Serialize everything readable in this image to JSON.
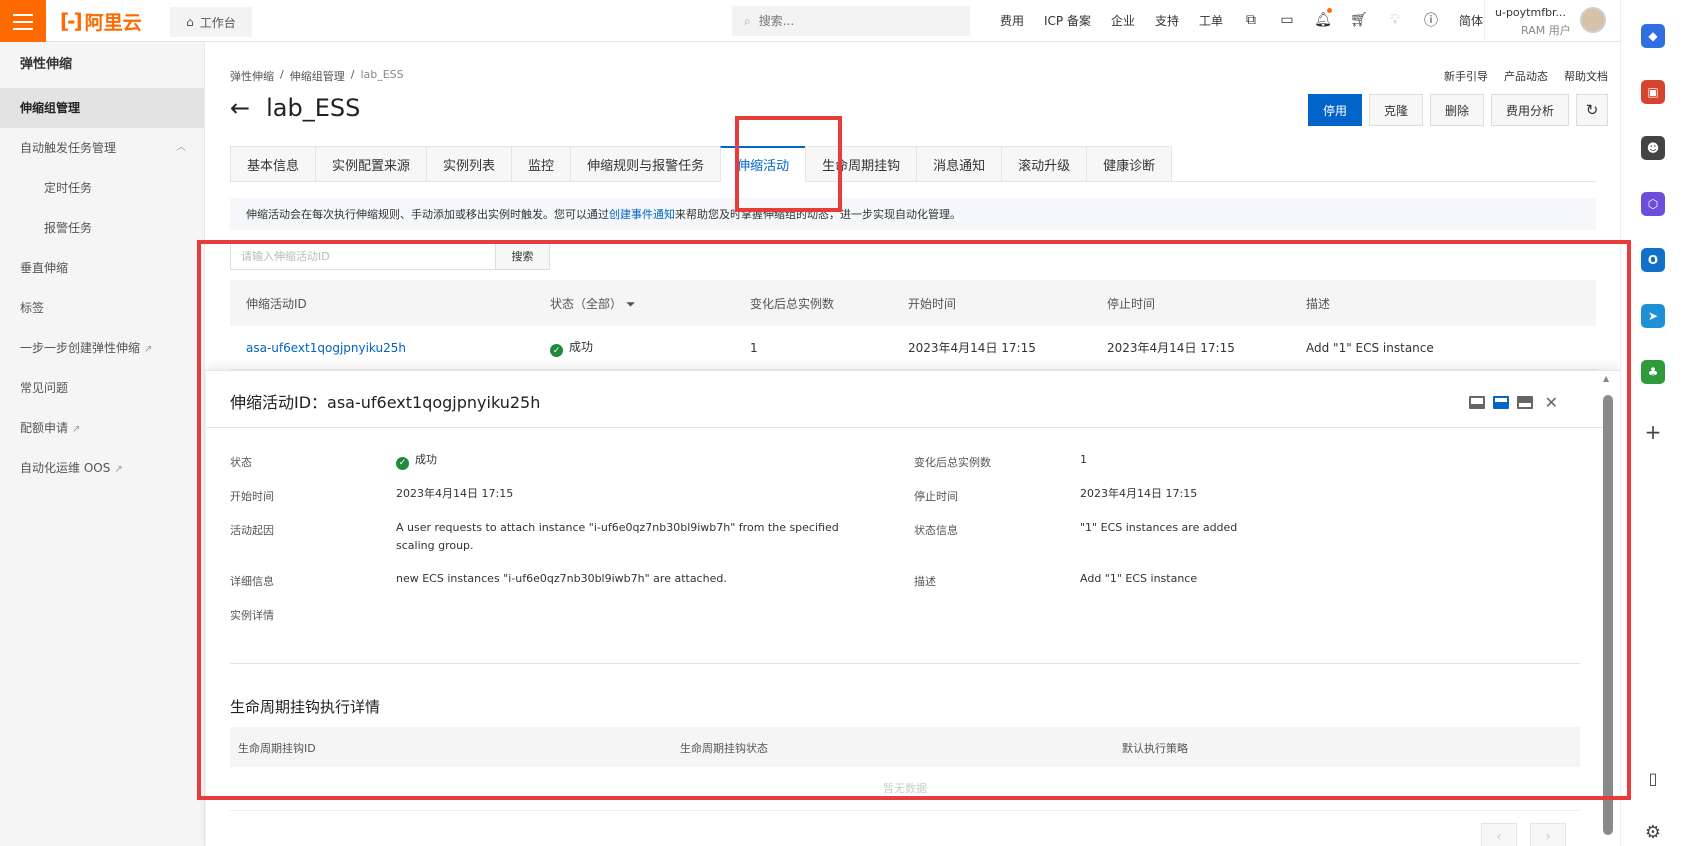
{
  "topbar": {
    "logo_text": "阿里云",
    "workbench_label": "工作台",
    "search_placeholder": "搜索...",
    "nav": [
      "费用",
      "ICP 备案",
      "企业",
      "支持",
      "工单"
    ],
    "lang": "简体",
    "user_name": "u-poytmfbr...",
    "user_role": "RAM 用户"
  },
  "sidebar": {
    "title": "弹性伸缩",
    "items": [
      {
        "label": "伸缩组管理"
      },
      {
        "label": "自动触发任务管理"
      },
      {
        "label": "定时任务"
      },
      {
        "label": "报警任务"
      },
      {
        "label": "垂直伸缩"
      },
      {
        "label": "标签"
      },
      {
        "label": "一步一步创建弹性伸缩"
      },
      {
        "label": "常见问题"
      },
      {
        "label": "配额申请"
      },
      {
        "label": "自动化运维 OOS"
      }
    ]
  },
  "breadcrumb": [
    "弹性伸缩",
    "伸缩组管理",
    "lab_ESS"
  ],
  "toplinks": [
    "新手引导",
    "产品动态",
    "帮助文档"
  ],
  "page": {
    "title": "lab_ESS",
    "actions": [
      "停用",
      "克隆",
      "删除",
      "费用分析"
    ]
  },
  "tabs": [
    "基本信息",
    "实例配置来源",
    "实例列表",
    "监控",
    "伸缩规则与报警任务",
    "伸缩活动",
    "生命周期挂钩",
    "消息通知",
    "滚动升级",
    "健康诊断"
  ],
  "notice": {
    "before": "伸缩活动会在每次执行伸缩规则、手动添加或移出实例时触发。您可以通过",
    "link": "创建事件通知",
    "after": "来帮助您及时掌握伸缩组的动态，进一步实现自动化管理。"
  },
  "activity_search": {
    "placeholder": "请输入伸缩活动ID",
    "button": "搜索"
  },
  "table": {
    "headers": [
      "伸缩活动ID",
      "状态（全部）",
      "变化后总实例数",
      "开始时间",
      "停止时间",
      "描述"
    ],
    "rows": [
      {
        "id": "asa-uf6ext1qogjpnyiku25h",
        "status": "成功",
        "total": "1",
        "start": "2023年4月14日 17:15",
        "stop": "2023年4月14日 17:15",
        "desc": "Add \"1\" ECS instance"
      }
    ]
  },
  "detail": {
    "title": "伸缩活动ID：asa-uf6ext1qogjpnyiku25h",
    "status_label": "状态",
    "status_value": "成功",
    "total_label": "变化后总实例数",
    "total_value": "1",
    "start_label": "开始时间",
    "start_value": "2023年4月14日 17:15",
    "stop_label": "停止时间",
    "stop_value": "2023年4月14日 17:15",
    "cause_label": "活动起因",
    "cause_value": "A user requests to attach instance \"i-uf6e0qz7nb30bl9iwb7h\" from the specified scaling group.",
    "statusinfo_label": "状态信息",
    "statusinfo_value": "\"1\" ECS instances are added",
    "detail_label": "详细信息",
    "detail_value": "new ECS instances \"i-uf6e0qz7nb30bl9iwb7h\" are attached.",
    "desc_label": "描述",
    "desc_value": "Add \"1\" ECS instance",
    "instance_label": "实例详情",
    "lifecycle_title": "生命周期挂钩执行详情",
    "lifecycle_headers": [
      "生命周期挂钩ID",
      "生命周期挂钩状态",
      "默认执行策略"
    ],
    "empty_text": "暂无数据"
  },
  "colors": {
    "brand": "#ff6a00",
    "primary": "#0064c8",
    "success": "#1f8a3b",
    "highlight": "#ea3b3b"
  }
}
